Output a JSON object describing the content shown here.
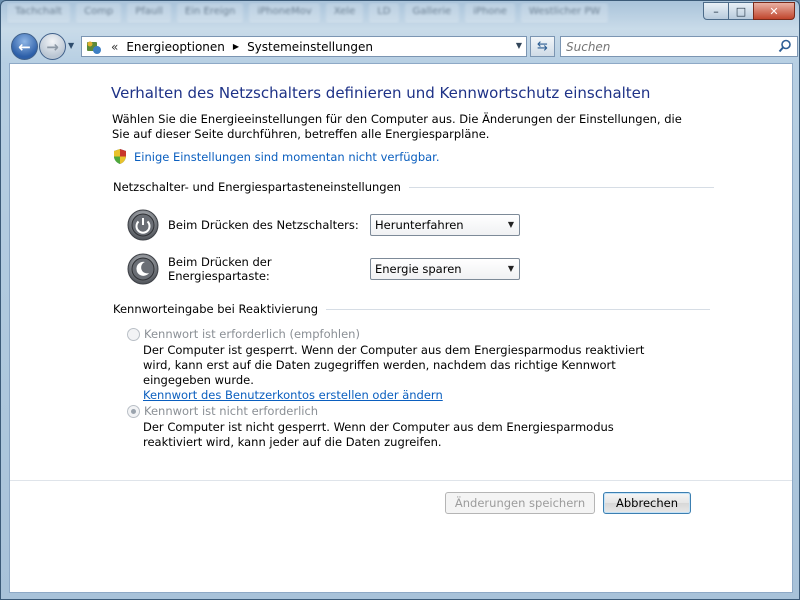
{
  "taskbar_blur": [
    "Tachchalt",
    "Comp",
    "Pfaull",
    "Ein Ereign",
    "iPhoneMov",
    "Xele",
    "LD",
    "Gallerie",
    "iPhone",
    "Westlicher PW"
  ],
  "window": {
    "caption_minimize": "–",
    "caption_maximize": "□",
    "caption_close": "✕"
  },
  "nav": {
    "back_glyph": "←",
    "forward_glyph": "→",
    "history_glyph": "▼",
    "breadcrumb_overflow": "«",
    "breadcrumb": [
      "Energieoptionen",
      "Systemeinstellungen"
    ],
    "breadcrumb_separator": "▶",
    "address_dropdown_glyph": "▼",
    "refresh_glyph": "⇆",
    "search_placeholder": "Suchen"
  },
  "page": {
    "title": "Verhalten des Netzschalters definieren und Kennwortschutz einschalten",
    "intro": "Wählen Sie die Energieeinstellungen für den Computer aus. Die Änderungen der Einstellungen, die Sie auf dieser Seite durchführen, betreffen alle Energiesparpläne.",
    "admin_link": "Einige Einstellungen sind momentan nicht verfügbar."
  },
  "power_section": {
    "heading": "Netzschalter- und Energiespartasteneinstellungen",
    "power_button_label": "Beim Drücken des Netzschalters:",
    "power_button_value": "Herunterfahren",
    "sleep_button_label": "Beim Drücken der Energiespartaste:",
    "sleep_button_value": "Energie sparen",
    "dropdown_caret": "▼"
  },
  "password_section": {
    "heading": "Kennworteingabe bei Reaktivierung",
    "option_required_label": "Kennwort ist erforderlich (empfohlen)",
    "option_required_desc": "Der Computer ist gesperrt. Wenn der Computer aus dem Energiesparmodus reaktiviert wird, kann erst auf die Daten zugegriffen werden, nachdem das richtige Kennwort eingegeben wurde.",
    "create_password_link": "Kennwort des Benutzerkontos erstellen oder ändern",
    "option_not_required_label": "Kennwort ist nicht erforderlich",
    "option_not_required_desc": "Der Computer ist nicht gesperrt. Wenn der Computer aus dem Energiesparmodus reaktiviert wird, kann jeder auf die Daten zugreifen.",
    "selected_option": "not_required"
  },
  "buttons": {
    "save": "Änderungen speichern",
    "cancel": "Abbrechen"
  },
  "colors": {
    "title_blue": "#1e3287",
    "link_blue": "#0b5fbf",
    "disabled_gray": "#8a8f95"
  }
}
